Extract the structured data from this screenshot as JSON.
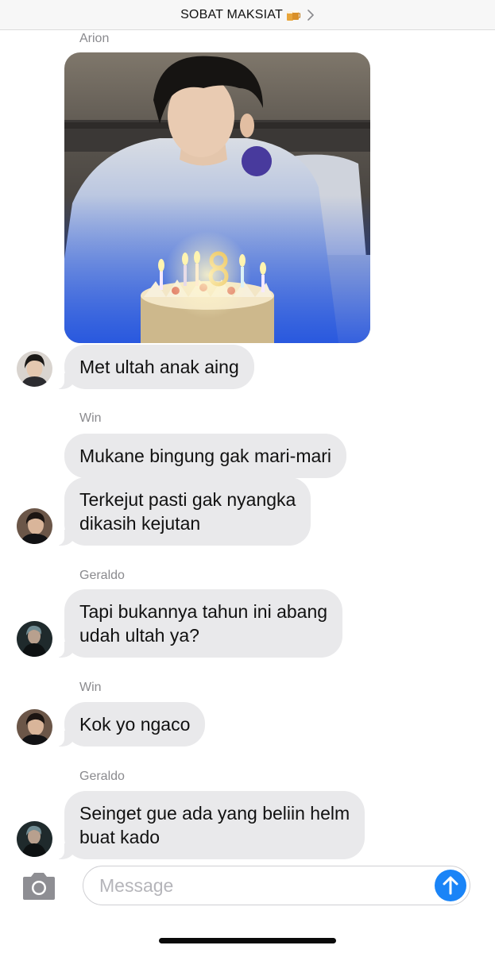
{
  "header": {
    "title": "SOBAT MAKSIAT",
    "emoji_icon": "beer-mugs-emoji-icon",
    "chevron_icon": "chevron-right-icon"
  },
  "messages": [
    {
      "sender": "Arion",
      "type": "photo",
      "description_icon": "birthday-photo"
    },
    {
      "type": "text",
      "text": "Met ultah anak aing"
    },
    {
      "sender": "Win",
      "type": "text",
      "text": "Mukane bingung gak mari-mari"
    },
    {
      "type": "text",
      "text": "Terkejut pasti gak nyangka\ndikasih kejutan"
    },
    {
      "sender": "Geraldo",
      "type": "text",
      "text": "Tapi bukannya tahun ini abang\nudah ultah ya?"
    },
    {
      "sender": "Win",
      "type": "text",
      "text": "Kok yo ngaco"
    },
    {
      "sender": "Geraldo",
      "type": "text",
      "text": "Seinget gue ada yang beliin helm\nbuat kado"
    }
  ],
  "composer": {
    "placeholder": "Message",
    "camera_icon": "camera-icon",
    "send_icon": "arrow-up-icon"
  },
  "colors": {
    "bubble": "#e9e9eb",
    "send_button": "#1a84f7",
    "sender_name": "#8a8a8e"
  }
}
